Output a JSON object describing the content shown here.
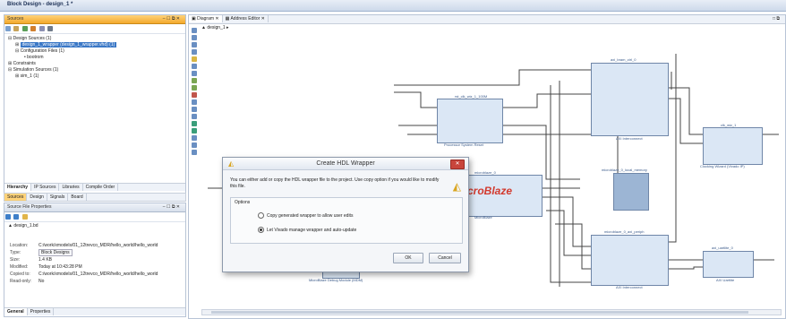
{
  "window": {
    "title": "Block Design - design_1 *"
  },
  "sources": {
    "title": "Sources",
    "controls": "– ☐ ⧉ ✕",
    "tree": [
      {
        "label": "Design Sources (1)",
        "indent": 0
      },
      {
        "label": "design_1_wrapper (design_1_wrapper.vhd) (1)",
        "indent": 1
      },
      {
        "label": "Configuration Files (1)",
        "indent": 1
      },
      {
        "label": "bootrom",
        "indent": 2
      },
      {
        "label": "Constraints",
        "indent": 0
      },
      {
        "label": "Simulation Sources (1)",
        "indent": 0
      },
      {
        "label": "sim_1 (1)",
        "indent": 1
      }
    ],
    "bottom_tabs": [
      "Hierarchy",
      "IP Sources",
      "Libraries",
      "Compile Order"
    ],
    "sub_tabs": [
      "Sources",
      "Design",
      "Signals",
      "Board"
    ]
  },
  "properties": {
    "title": "Source File Properties",
    "controls": "– ☐ ⧉ ✕",
    "file": "design_1.bd",
    "rows": [
      {
        "key": "Location:",
        "value": "C:/work/xmodels/01_12trevco_MDR/hello_world/hello_world"
      },
      {
        "key": "Type:",
        "value": "Block Designs"
      },
      {
        "key": "Size:",
        "value": "1.4 KB"
      },
      {
        "key": "Modified:",
        "value": "Today at 10:43:28 PM"
      },
      {
        "key": "Copied to:",
        "value": "C:/work/xmodels/01_12trevco_MDR/hello_world/hello_world"
      },
      {
        "key": "Read-only:",
        "value": "No"
      }
    ],
    "tabs": [
      "General",
      "Properties"
    ]
  },
  "editor": {
    "tabs": [
      "Diagram",
      "Address Editor"
    ],
    "crumb": "design_1",
    "corner": "□ ⧉"
  },
  "diagram": {
    "blocks": [
      {
        "name": "rst_clk_wiz_1_100M",
        "caption": "Processor System Reset"
      },
      {
        "name": "axi_bram_ctrl_0",
        "caption": "AXI Interconnect"
      },
      {
        "name": "microblaze_0",
        "caption": "MicroBlaze"
      },
      {
        "name": "microblaze_0_local_memory",
        "caption": ""
      },
      {
        "name": "clk_wiz_1",
        "caption": "Clocking Wizard (Vivado IP)"
      },
      {
        "name": "microblaze_0_axi_periph",
        "caption": "AXI Interconnect"
      },
      {
        "name": "mdm_1",
        "caption": "MicroBlaze Debug Module (MDM)"
      },
      {
        "name": "axi_uartlite_0",
        "caption": "AXI Uartlite"
      }
    ],
    "mb_logo": "croBlaze"
  },
  "dialog": {
    "title": "Create HDL Wrapper",
    "message": "You can either add or copy the HDL wrapper file to the project. Use copy option if you would like to modify this file.",
    "options_label": "Options",
    "option1": "Copy generated wrapper to allow user edits",
    "option2": "Let Vivado manage wrapper and auto-update",
    "ok": "OK",
    "cancel": "Cancel",
    "close": "✕"
  }
}
